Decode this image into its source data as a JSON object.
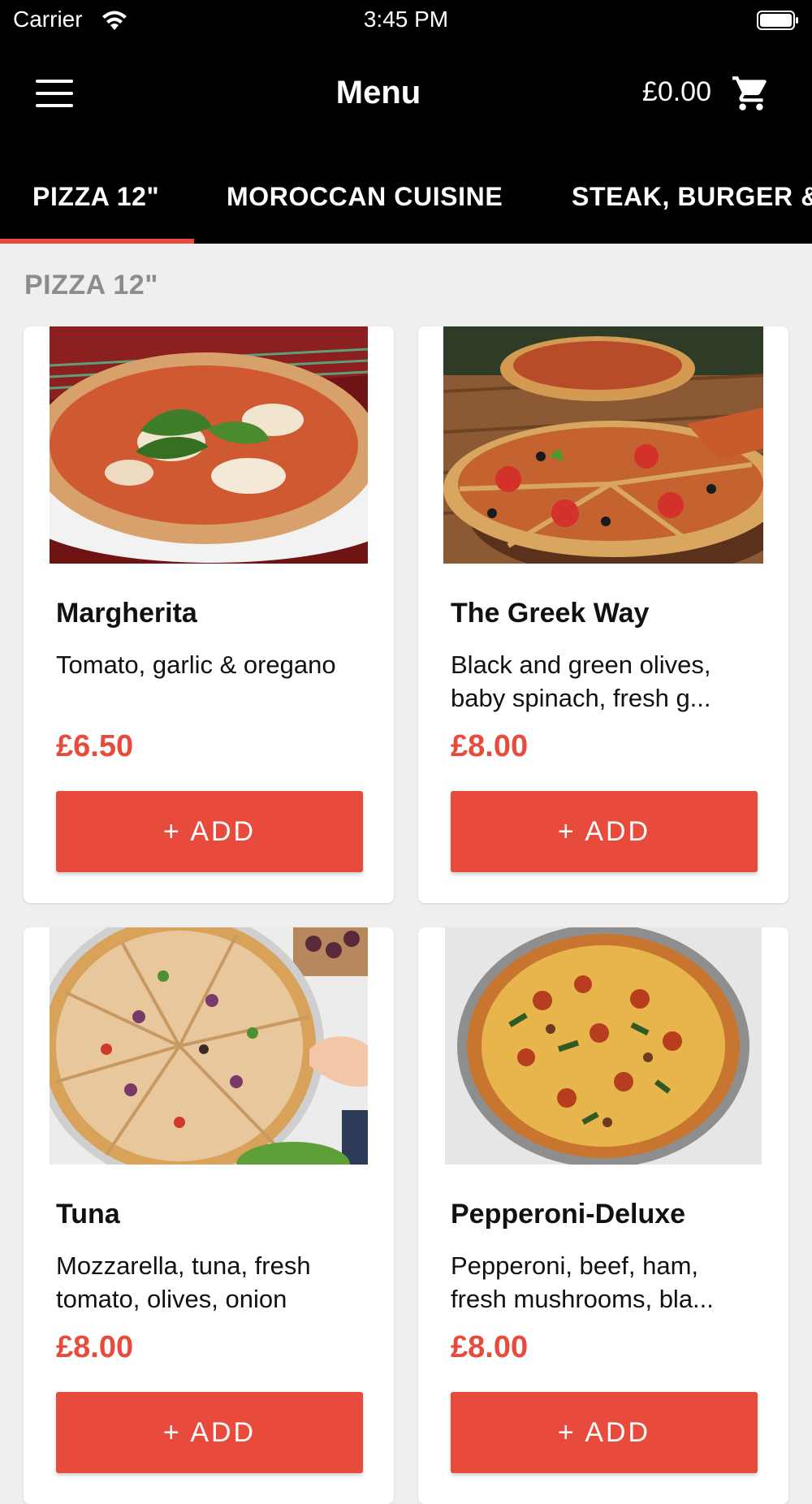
{
  "status_bar": {
    "carrier": "Carrier",
    "time": "3:45 PM",
    "wifi_icon": "wifi-icon",
    "battery_icon": "battery-icon"
  },
  "header": {
    "title": "Menu",
    "cart_total": "£0.00",
    "menu_icon": "hamburger-menu-icon",
    "cart_icon": "shopping-cart-icon"
  },
  "tabs": [
    {
      "label": "PIZZA 12\"",
      "active": true
    },
    {
      "label": "MOROCCAN CUISINE",
      "active": false
    },
    {
      "label": "STEAK, BURGER &",
      "active": false
    }
  ],
  "section": {
    "title": "PIZZA 12\""
  },
  "items": [
    {
      "name": "Margherita",
      "description": "Tomato, garlic & oregano",
      "price": "£6.50",
      "button": "+ ADD"
    },
    {
      "name": "The Greek Way",
      "description": "Black and green olives, baby spinach, fresh  g...",
      "price": "£8.00",
      "button": "+ ADD"
    },
    {
      "name": "Tuna",
      "description": "Mozzarella, tuna, fresh tomato, olives, onion",
      "price": "£8.00",
      "button": "+ ADD"
    },
    {
      "name": "Pepperoni-Deluxe",
      "description": " Pepperoni, beef, ham, fresh mushrooms, bla...",
      "price": "£8.00",
      "button": "+ ADD"
    }
  ],
  "colors": {
    "accent": "#e84b3c",
    "header_background": "#000000",
    "page_background": "#efefef",
    "section_title": "#8c8c8c"
  }
}
